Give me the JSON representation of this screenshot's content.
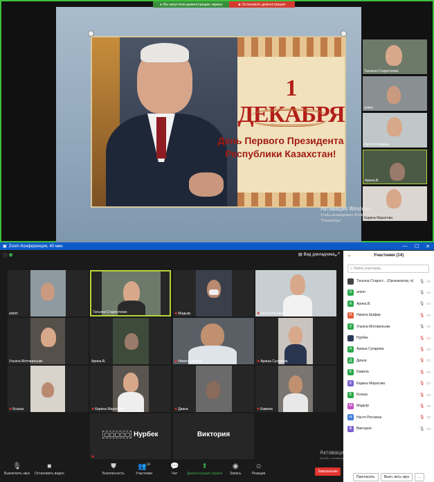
{
  "share_bar": {
    "status": "Вы запустили демонстрацию экрана",
    "stop_label": "Остановить демонстрацию"
  },
  "slide": {
    "title": "1 ДЕКАБРЯ",
    "subtitle_line1": "День Первого Президента",
    "subtitle_line2": "Республики Казахстан!"
  },
  "top_thumbs": [
    {
      "name": "Татьяна Старостенко"
    },
    {
      "name": "artem"
    },
    {
      "name": "Настя Рогозина"
    },
    {
      "name": "Арина.В."
    },
    {
      "name": "Карина Маратова"
    }
  ],
  "windows_activation_top": {
    "title": "Активация Windows",
    "text": "Чтобы активировать Windows, перейдите в раздел \"Параметры\"."
  },
  "zoom": {
    "window_title": "Zoom Конференция, 40 мин",
    "view_label": "Вид докладчика",
    "tiles": [
      {
        "name": "artem",
        "muted": false,
        "video": true
      },
      {
        "name": "Татьяна Старостенко",
        "muted": false,
        "video": true,
        "active": true
      },
      {
        "name": "Мадьяр",
        "muted": true,
        "video": true
      },
      {
        "name": "Настя Рогозина",
        "muted": true,
        "video": true
      },
      {
        "name": "Ульяна Мотовильник",
        "muted": false,
        "video": true
      },
      {
        "name": "Арина.В.",
        "muted": false,
        "video": true
      },
      {
        "name": "Никита Шафир",
        "muted": true,
        "video": true
      },
      {
        "name": "Ариша Сухарева",
        "muted": true,
        "video": true
      },
      {
        "name": "Ксюша",
        "muted": true,
        "video": true
      },
      {
        "name": "Карина Маратова",
        "muted": true,
        "video": true
      },
      {
        "name": "Диана",
        "muted": true,
        "video": true
      },
      {
        "name": "Камила",
        "muted": true,
        "video": true
      },
      {
        "name": "Нурбек",
        "muted": true,
        "video": false,
        "big": "Нурбек"
      },
      {
        "name": "Виктория",
        "muted": false,
        "video": false,
        "big": "Виктория"
      }
    ],
    "toolbar": {
      "mute": "Выключить звук",
      "video": "Остановить видео",
      "security": "Безопасность",
      "participants": "Участники",
      "participants_count": "14",
      "chat": "Чат",
      "share": "Демонстрация экрана",
      "record": "Запись",
      "reactions": "Реакции",
      "end": "Завершение"
    },
    "windows_activation": {
      "title": "Активация Windows",
      "text": "Чтобы активировать Windows, перейдите в раздел \"Параметры\"."
    }
  },
  "participants": {
    "title": "Участники (14)",
    "search_placeholder": "Найти участника",
    "list": [
      {
        "initial": "",
        "name": "Татьяна Старост... (Организатор, я)",
        "color": "#444444",
        "mic_muted": false,
        "cam_off": false
      },
      {
        "initial": "A",
        "name": "artem",
        "color": "#2aa84a",
        "mic_muted": false,
        "cam_off": false
      },
      {
        "initial": "A",
        "name": "Арина.В.",
        "color": "#2aa84a",
        "mic_muted": false,
        "cam_off": false
      },
      {
        "initial": "H",
        "name": "Никита Шафир",
        "color": "#e35b3c",
        "mic_muted": true,
        "cam_off": false
      },
      {
        "initial": "У",
        "name": "Ульяна Мотовильник",
        "color": "#2aa84a",
        "mic_muted": false,
        "cam_off": false
      },
      {
        "initial": "",
        "name": "Нурбек",
        "color": "#2b3a5a",
        "mic_muted": true,
        "cam_off": true
      },
      {
        "initial": "A",
        "name": "Ариша Сухарева",
        "color": "#2aa84a",
        "mic_muted": true,
        "cam_off": false
      },
      {
        "initial": "Д",
        "name": "Диана",
        "color": "#2aa84a",
        "mic_muted": true,
        "cam_off": false
      },
      {
        "initial": "K",
        "name": "Камила",
        "color": "#2aa84a",
        "mic_muted": true,
        "cam_off": false
      },
      {
        "initial": "K",
        "name": "Карина Маратова",
        "color": "#7b5fd0",
        "mic_muted": true,
        "cam_off": false
      },
      {
        "initial": "K",
        "name": "Ксюша",
        "color": "#2aa84a",
        "mic_muted": true,
        "cam_off": false
      },
      {
        "initial": "M",
        "name": "Мадьяр",
        "color": "#c04fc0",
        "mic_muted": true,
        "cam_off": false
      },
      {
        "initial": "H",
        "name": "Настя Рогозина",
        "color": "#3d7bd6",
        "mic_muted": true,
        "cam_off": false
      },
      {
        "initial": "B",
        "name": "Виктория",
        "color": "#7b5fd0",
        "mic_muted": false,
        "cam_off": false
      }
    ],
    "invite_label": "Пригласить",
    "mute_all_label": "Выкл. весь звук",
    "more_label": "..."
  }
}
